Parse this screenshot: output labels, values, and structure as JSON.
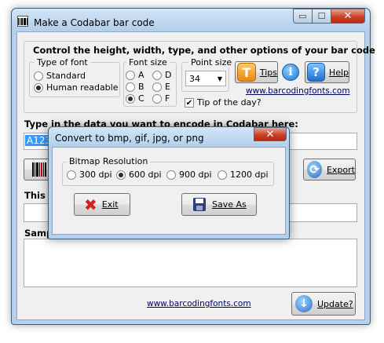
{
  "window": {
    "title": "Make a Codabar bar code",
    "min_glyph": "▭",
    "max_glyph": "☐",
    "close_glyph": "✕"
  },
  "options": {
    "heading": "Control the height, width, type, and other options of your bar code",
    "font_type": {
      "title": "Type of font",
      "options": [
        "Standard",
        "Human readable"
      ],
      "selected": "Human readable"
    },
    "font_size": {
      "title": "Font size",
      "options": [
        "A",
        "B",
        "C",
        "D",
        "E",
        "F"
      ],
      "selected": "C"
    },
    "point_size": {
      "title": "Point size",
      "value": "34"
    },
    "tips_label": "Tips",
    "help_label": "Help",
    "website": "www.barcodingfonts.com",
    "tip_of_day_label": "Tip of the day?",
    "tip_of_day_checked": true
  },
  "data_entry": {
    "label": "Type in the data you want to encode in Codabar here:",
    "value": "A123"
  },
  "actions": {
    "export_label": "Export"
  },
  "sections": {
    "this_label": "This i",
    "sample_label": "Samp"
  },
  "footer": {
    "website": "www.barcodingfonts.com",
    "update_label": "Update?"
  },
  "dialog": {
    "title": "Convert to bmp, gif, jpg, or png",
    "group_title": "Bitmap Resolution",
    "resolutions": [
      "300 dpi",
      "600 dpi",
      "900 dpi",
      "1200 dpi"
    ],
    "selected": "600 dpi",
    "exit_label": "Exit",
    "save_label": "Save As",
    "close_glyph": "✕"
  },
  "colors": {
    "accent_orange": "#f0a020",
    "help_blue": "#2a7fd4",
    "close_red": "#c8412a",
    "link": "#000066"
  }
}
